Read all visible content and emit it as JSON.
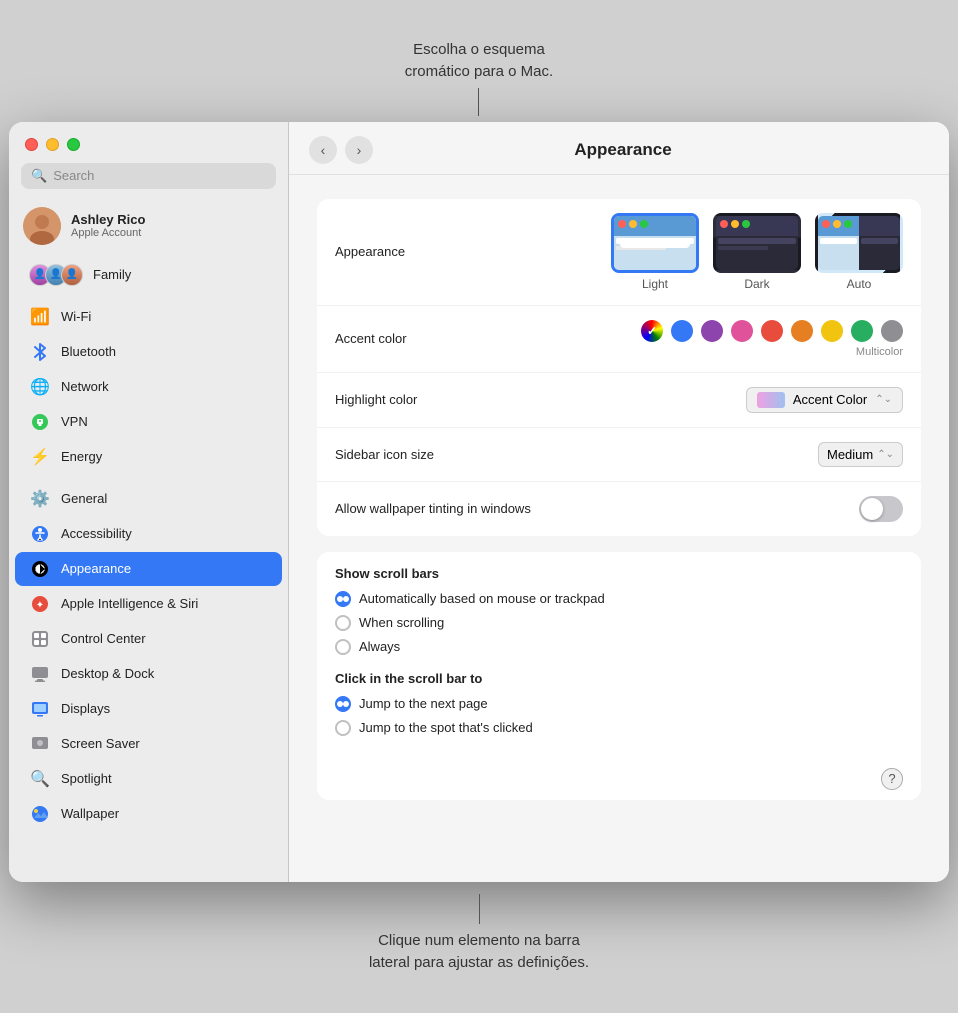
{
  "callout_top": {
    "line1": "Escolha o esquema",
    "line2": "cromático para o Mac."
  },
  "callout_bottom": {
    "line1": "Clique num elemento na barra",
    "line2": "lateral para ajustar as definições."
  },
  "window": {
    "title": "Appearance"
  },
  "sidebar": {
    "search_placeholder": "Search",
    "user": {
      "name": "Ashley Rico",
      "subtitle": "Apple Account"
    },
    "family_label": "Family",
    "items": [
      {
        "id": "wifi",
        "label": "Wi-Fi",
        "icon": "📶"
      },
      {
        "id": "bluetooth",
        "label": "Bluetooth",
        "icon": "✦"
      },
      {
        "id": "network",
        "label": "Network",
        "icon": "🌐"
      },
      {
        "id": "vpn",
        "label": "VPN",
        "icon": "🔒"
      },
      {
        "id": "energy",
        "label": "Energy",
        "icon": "⚡"
      },
      {
        "id": "general",
        "label": "General",
        "icon": "⚙"
      },
      {
        "id": "accessibility",
        "label": "Accessibility",
        "icon": "ⓘ"
      },
      {
        "id": "appearance",
        "label": "Appearance",
        "icon": "👁",
        "active": true
      },
      {
        "id": "siri",
        "label": "Apple Intelligence & Siri",
        "icon": "✦"
      },
      {
        "id": "controlcenter",
        "label": "Control Center",
        "icon": "▦"
      },
      {
        "id": "desktop",
        "label": "Desktop & Dock",
        "icon": "▭"
      },
      {
        "id": "displays",
        "label": "Displays",
        "icon": "✦"
      },
      {
        "id": "screensaver",
        "label": "Screen Saver",
        "icon": "▣"
      },
      {
        "id": "spotlight",
        "label": "Spotlight",
        "icon": "🔍"
      },
      {
        "id": "wallpaper",
        "label": "Wallpaper",
        "icon": "✦"
      }
    ]
  },
  "main": {
    "title": "Appearance",
    "sections": {
      "appearance": {
        "label": "Appearance",
        "modes": [
          {
            "id": "light",
            "label": "Light",
            "selected": true
          },
          {
            "id": "dark",
            "label": "Dark",
            "selected": false
          },
          {
            "id": "auto",
            "label": "Auto",
            "selected": false
          }
        ]
      },
      "accent_color": {
        "label": "Accent color",
        "sublabel": "Multicolor",
        "colors": [
          {
            "id": "multicolor",
            "color": "#cca0e0",
            "selected": true
          },
          {
            "id": "blue",
            "color": "#3478f6"
          },
          {
            "id": "purple",
            "color": "#8e44ad"
          },
          {
            "id": "pink",
            "color": "#e0529a"
          },
          {
            "id": "red",
            "color": "#e74c3c"
          },
          {
            "id": "orange",
            "color": "#e67e22"
          },
          {
            "id": "yellow",
            "color": "#f1c40f"
          },
          {
            "id": "green",
            "color": "#27ae60"
          },
          {
            "id": "graphite",
            "color": "#8e8e93"
          }
        ]
      },
      "highlight_color": {
        "label": "Highlight color",
        "value": "Accent Color"
      },
      "sidebar_icon_size": {
        "label": "Sidebar icon size",
        "value": "Medium"
      },
      "wallpaper_tinting": {
        "label": "Allow wallpaper tinting in windows",
        "enabled": false
      }
    },
    "scroll_bars": {
      "title": "Show scroll bars",
      "options": [
        {
          "id": "auto",
          "label": "Automatically based on mouse or trackpad",
          "checked": true
        },
        {
          "id": "scrolling",
          "label": "When scrolling",
          "checked": false
        },
        {
          "id": "always",
          "label": "Always",
          "checked": false
        }
      ]
    },
    "scroll_click": {
      "title": "Click in the scroll bar to",
      "options": [
        {
          "id": "next_page",
          "label": "Jump to the next page",
          "checked": true
        },
        {
          "id": "clicked_spot",
          "label": "Jump to the spot that's clicked",
          "checked": false
        }
      ]
    }
  }
}
